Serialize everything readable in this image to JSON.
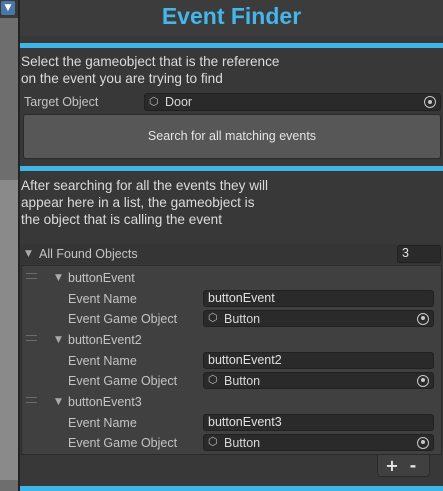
{
  "header": {
    "title": "Event Finder"
  },
  "section1": {
    "instruction_line1": "Select the gameobject that is the reference",
    "instruction_line2": "on the event you are trying to find",
    "target_label": "Target Object",
    "target_value": "Door",
    "search_button": "Search for all matching events"
  },
  "section2": {
    "instruction_line1": "After searching for all the events they will",
    "instruction_line2": "appear here in a list, the gameobject is",
    "instruction_line3": "the object that is calling the event"
  },
  "list": {
    "title": "All Found Objects",
    "count": "3",
    "items": [
      {
        "name": "buttonEvent",
        "event_name_label": "Event Name",
        "event_name": "buttonEvent",
        "object_label": "Event Game Object",
        "object": "Button"
      },
      {
        "name": "buttonEvent2",
        "event_name_label": "Event Name",
        "event_name": "buttonEvent2",
        "object_label": "Event Game Object",
        "object": "Button"
      },
      {
        "name": "buttonEvent3",
        "event_name_label": "Event Name",
        "event_name": "buttonEvent3",
        "object_label": "Event Game Object",
        "object": "Button"
      }
    ],
    "add_label": "+",
    "remove_label": "-"
  },
  "colors": {
    "accent": "#3fb5e7",
    "title": "#45b6ec",
    "background": "#383838"
  },
  "icons": {
    "foldout": "triangle-down-icon",
    "object": "cube-icon",
    "picker": "object-picker-icon",
    "drag": "drag-handle-icon"
  }
}
